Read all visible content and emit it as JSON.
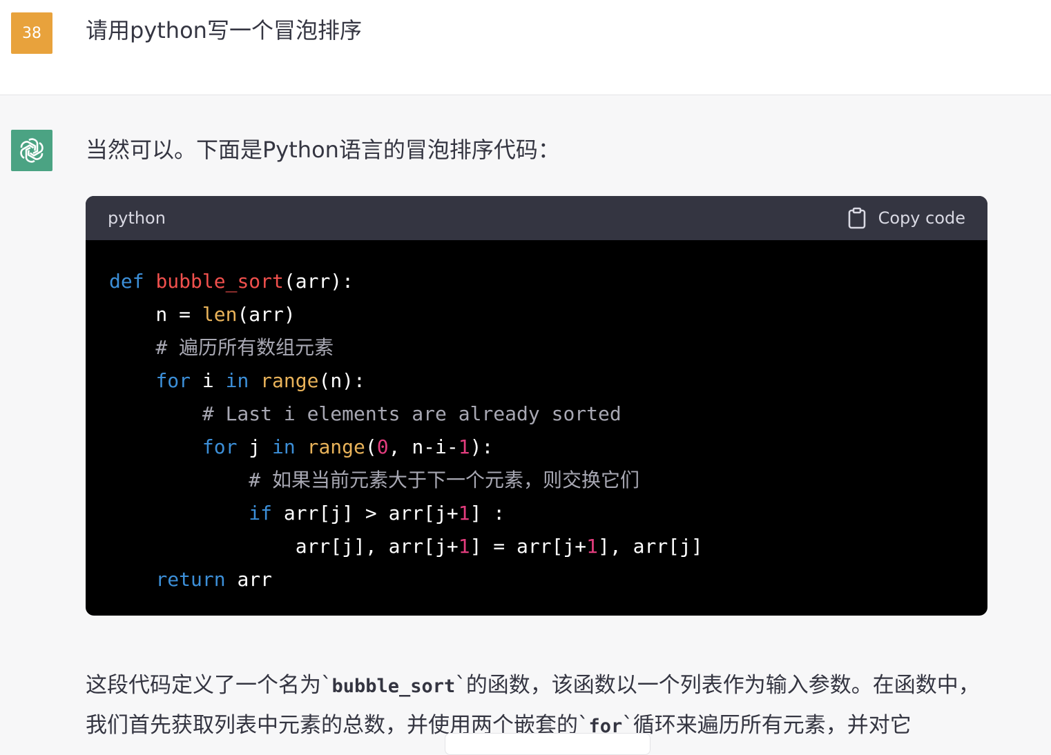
{
  "user": {
    "avatar_text": "38",
    "message": "请用python写一个冒泡排序"
  },
  "assistant": {
    "avatar_icon": "openai-logo-icon",
    "intro": "当然可以。下面是Python语言的冒泡排序代码：",
    "code_block": {
      "language": "python",
      "copy_label": "Copy code",
      "copy_icon": "clipboard-icon",
      "lines": [
        [
          {
            "t": "def",
            "c": "kw"
          },
          {
            "t": " "
          },
          {
            "t": "bubble_sort",
            "c": "fn"
          },
          {
            "t": "(arr):"
          }
        ],
        [
          {
            "t": "    n = "
          },
          {
            "t": "len",
            "c": "bi"
          },
          {
            "t": "(arr)"
          }
        ],
        [
          {
            "t": "    # 遍历所有数组元素",
            "c": "cm"
          }
        ],
        [
          {
            "t": "    "
          },
          {
            "t": "for",
            "c": "kw"
          },
          {
            "t": " i "
          },
          {
            "t": "in",
            "c": "kw"
          },
          {
            "t": " "
          },
          {
            "t": "range",
            "c": "bi"
          },
          {
            "t": "(n):"
          }
        ],
        [
          {
            "t": "        # Last i elements are already sorted",
            "c": "cm"
          }
        ],
        [
          {
            "t": "        "
          },
          {
            "t": "for",
            "c": "kw"
          },
          {
            "t": " j "
          },
          {
            "t": "in",
            "c": "kw"
          },
          {
            "t": " "
          },
          {
            "t": "range",
            "c": "bi"
          },
          {
            "t": "("
          },
          {
            "t": "0",
            "c": "num"
          },
          {
            "t": ", n-i-"
          },
          {
            "t": "1",
            "c": "num"
          },
          {
            "t": "):"
          }
        ],
        [
          {
            "t": "            # 如果当前元素大于下一个元素，则交换它们",
            "c": "cm"
          }
        ],
        [
          {
            "t": "            "
          },
          {
            "t": "if",
            "c": "kw"
          },
          {
            "t": " arr[j] > arr[j+"
          },
          {
            "t": "1",
            "c": "num"
          },
          {
            "t": "] :"
          }
        ],
        [
          {
            "t": "                arr[j], arr[j+"
          },
          {
            "t": "1",
            "c": "num"
          },
          {
            "t": "] = arr[j+"
          },
          {
            "t": "1",
            "c": "num"
          },
          {
            "t": "], arr[j]"
          }
        ],
        [
          {
            "t": "    "
          },
          {
            "t": "return",
            "c": "kw"
          },
          {
            "t": " arr"
          }
        ]
      ]
    },
    "explanation": [
      {
        "t": "这段代码定义了一个名为`"
      },
      {
        "t": "bubble_sort",
        "code": true
      },
      {
        "t": "`的函数，该函数以一个列表作为输入参数。在函数中，我们首先获取列表中元素的总数，并使用两个嵌套的`"
      },
      {
        "t": "for",
        "code": true
      },
      {
        "t": "`循环来遍历所有元素，并对它"
      }
    ]
  }
}
